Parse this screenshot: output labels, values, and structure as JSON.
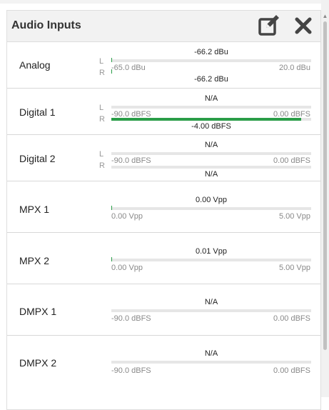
{
  "panel": {
    "title": "Audio Inputs",
    "edit_icon": "edit-icon",
    "close_icon": "close-icon"
  },
  "colors": {
    "level": "#2a9d48",
    "track": "#e6e6e6"
  },
  "inputs": [
    {
      "label": "Analog",
      "stereo": true,
      "ch_left": "L",
      "ch_right": "R",
      "top_value": "-66.2 dBu",
      "bottom_value": "-66.2 dBu",
      "min": "-65.0 dBu",
      "max": "20.0 dBu",
      "level_left": 0.0,
      "level_right": 0.0
    },
    {
      "label": "Digital 1",
      "stereo": true,
      "ch_left": "L",
      "ch_right": "R",
      "top_value": "N/A",
      "bottom_value": "-4.00 dBFS",
      "min": "-90.0 dBFS",
      "max": "0.00 dBFS",
      "level_left": 0.0,
      "level_right": 0.95
    },
    {
      "label": "Digital 2",
      "stereo": true,
      "ch_left": "L",
      "ch_right": "R",
      "top_value": "N/A",
      "bottom_value": "N/A",
      "min": "-90.0 dBFS",
      "max": "0.00 dBFS",
      "level_left": 0.0,
      "level_right": 0.0
    },
    {
      "label": "MPX 1",
      "stereo": false,
      "top_value": "0.00 Vpp",
      "min": "0.00 Vpp",
      "max": "5.00 Vpp",
      "level": 0.0
    },
    {
      "label": "MPX 2",
      "stereo": false,
      "top_value": "0.01 Vpp",
      "min": "0.00 Vpp",
      "max": "5.00 Vpp",
      "level": 0.0
    },
    {
      "label": "DMPX 1",
      "stereo": false,
      "top_value": "N/A",
      "min": "-90.0 dBFS",
      "max": "0.00 dBFS",
      "level": 0.0
    },
    {
      "label": "DMPX 2",
      "stereo": false,
      "top_value": "N/A",
      "min": "-90.0 dBFS",
      "max": "0.00 dBFS",
      "level": 0.0
    }
  ]
}
